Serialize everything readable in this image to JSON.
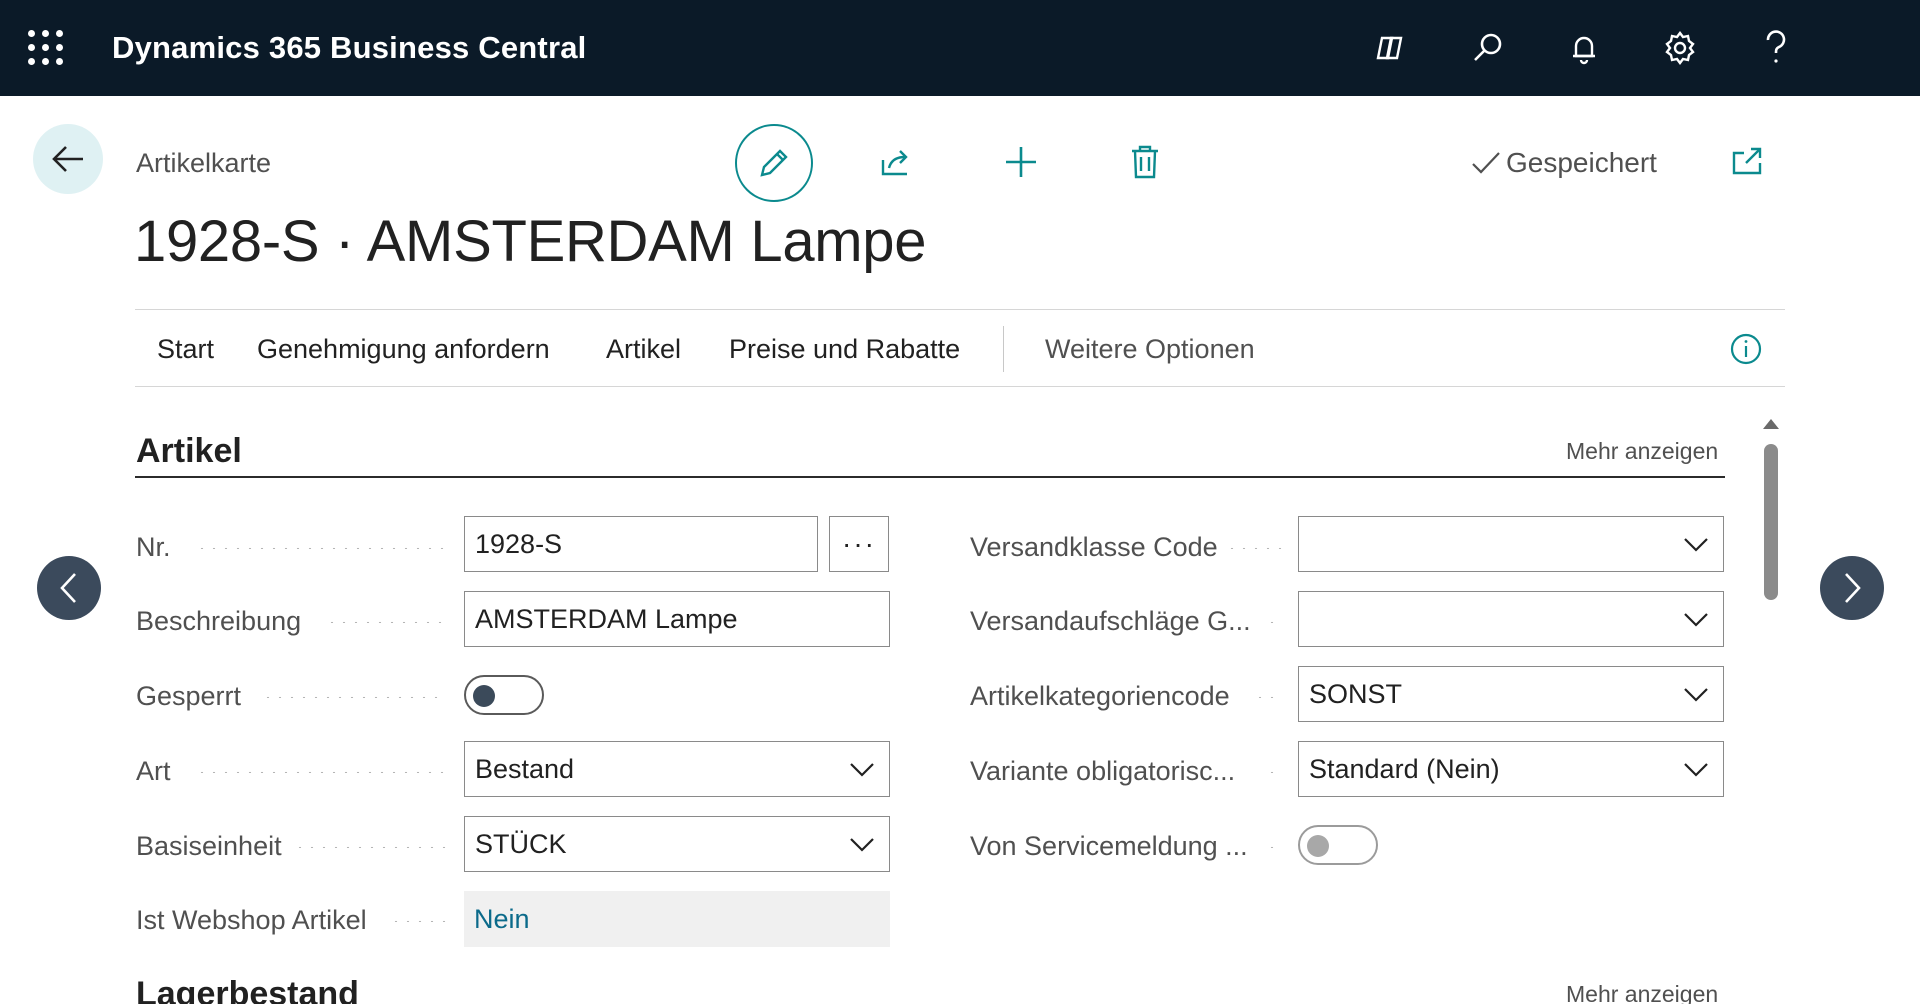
{
  "app": {
    "title": "Dynamics 365 Business Central"
  },
  "header": {
    "breadcrumb": "Artikelkarte",
    "page_title": "1928-S · AMSTERDAM Lampe",
    "saved_status": "Gespeichert"
  },
  "actions": {
    "items": [
      "Start",
      "Genehmigung anfordern",
      "Artikel",
      "Preise und Rabatte"
    ],
    "more": "Weitere Optionen"
  },
  "section": {
    "title": "Artikel",
    "more_link": "Mehr anzeigen"
  },
  "fields_left": {
    "nr": {
      "label": "Nr.",
      "value": "1928-S"
    },
    "beschreibung": {
      "label": "Beschreibung",
      "value": "AMSTERDAM Lampe"
    },
    "gesperrt": {
      "label": "Gesperrt"
    },
    "art": {
      "label": "Art",
      "value": "Bestand"
    },
    "basiseinheit": {
      "label": "Basiseinheit",
      "value": "STÜCK"
    },
    "webshop": {
      "label": "Ist Webshop Artikel",
      "value": "Nein"
    }
  },
  "fields_right": {
    "versandklasse": {
      "label": "Versandklasse Code",
      "value": ""
    },
    "versandaufschlaege": {
      "label": "Versandaufschläge G...",
      "value": ""
    },
    "artikelkategorie": {
      "label": "Artikelkategoriencode",
      "value": "SONST"
    },
    "variante": {
      "label": "Variante obligatorisc...",
      "value": "Standard (Nein)"
    },
    "servicemeldung": {
      "label": "Von Servicemeldung ..."
    }
  },
  "section2": {
    "title": "Lagerbestand",
    "more_link": "Mehr anzeigen"
  },
  "colors": {
    "topbar": "#0b1a28",
    "accent": "#0b8a8e",
    "nav_button": "#3b4a5c"
  }
}
